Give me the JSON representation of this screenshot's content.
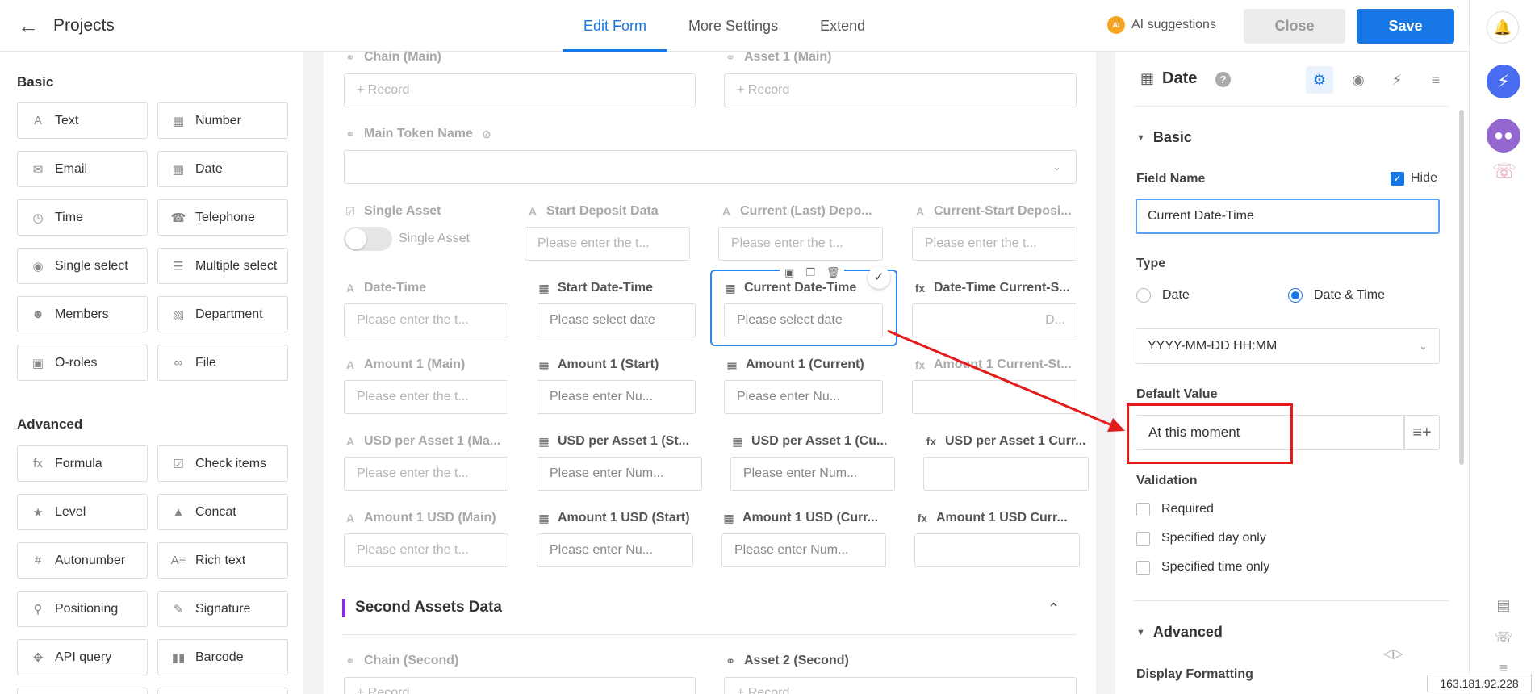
{
  "header": {
    "title": "Projects",
    "tabs": [
      "Edit Form",
      "More Settings",
      "Extend"
    ],
    "ai_suggestions": "AI suggestions",
    "ai_badge": "AI",
    "close": "Close",
    "save": "Save"
  },
  "sidebar": {
    "basic_title": "Basic",
    "advanced_title": "Advanced",
    "basic": [
      {
        "label": "Text",
        "icon": "text-icon"
      },
      {
        "label": "Number",
        "icon": "number-icon"
      },
      {
        "label": "Email",
        "icon": "email-icon"
      },
      {
        "label": "Date",
        "icon": "calendar-icon"
      },
      {
        "label": "Time",
        "icon": "clock-icon"
      },
      {
        "label": "Telephone",
        "icon": "phone-icon"
      },
      {
        "label": "Single select",
        "icon": "single-select-icon"
      },
      {
        "label": "Multiple select",
        "icon": "multi-select-icon"
      },
      {
        "label": "Members",
        "icon": "members-icon"
      },
      {
        "label": "Department",
        "icon": "department-icon"
      },
      {
        "label": "O-roles",
        "icon": "roles-icon"
      },
      {
        "label": "File",
        "icon": "attachment-icon"
      }
    ],
    "advanced": [
      {
        "label": "Formula",
        "icon": "formula-icon"
      },
      {
        "label": "Check items",
        "icon": "checkbox-icon"
      },
      {
        "label": "Level",
        "icon": "star-icon"
      },
      {
        "label": "Concat",
        "icon": "concat-icon"
      },
      {
        "label": "Autonumber",
        "icon": "hash-icon"
      },
      {
        "label": "Rich text",
        "icon": "rich-text-icon"
      },
      {
        "label": "Positioning",
        "icon": "location-icon"
      },
      {
        "label": "Signature",
        "icon": "signature-icon"
      },
      {
        "label": "API query",
        "icon": "api-icon"
      },
      {
        "label": "Barcode",
        "icon": "barcode-icon"
      }
    ]
  },
  "form": {
    "chain_main": "Chain (Main)",
    "asset1_main": "Asset 1 (Main)",
    "record": "+ Record",
    "main_token_name": "Main Token Name",
    "single_asset": "Single Asset",
    "single_asset_toggle": "Single Asset",
    "start_deposit_data": "Start Deposit Data",
    "current_last_depo": "Current (Last) Depo...",
    "current_start_deposi": "Current-Start Deposi...",
    "ph_text": "Please enter the t...",
    "date_time": "Date-Time",
    "start_date_time": "Start Date-Time",
    "current_date_time": "Current Date-Time",
    "date_time_current_s": "Date-Time Current-S...",
    "ph_select_date": "Please select date",
    "formula_placeholder": "D...",
    "amount1_main": "Amount 1 (Main)",
    "amount1_start": "Amount 1 (Start)",
    "amount1_current": "Amount 1 (Current)",
    "amount1_current_st": "Amount 1 Current-St...",
    "ph_num_short": "Please enter Nu...",
    "usd_asset1_main": "USD per Asset 1 (Ma...",
    "usd_asset1_start": "USD per Asset 1 (St...",
    "usd_asset1_current": "USD per Asset 1 (Cu...",
    "usd_asset1_curr": "USD per Asset 1 Curr...",
    "ph_num_long": "Please enter Num...",
    "amount1_usd_main": "Amount 1 USD (Main)",
    "amount1_usd_start": "Amount 1 USD (Start)",
    "amount1_usd_curr": "Amount 1 USD (Curr...",
    "amount1_usd_curr2": "Amount 1 USD Curr...",
    "second_assets": "Second Assets Data",
    "chain_second": "Chain (Second)",
    "asset2_second": "Asset 2 (Second)",
    "record_cut": "+ Record"
  },
  "panel": {
    "title": "Date",
    "basic": "Basic",
    "field_name_label": "Field Name",
    "hide": "Hide",
    "field_name_value": "Current Date-Time",
    "type_label": "Type",
    "type_date": "Date",
    "type_datetime": "Date & Time",
    "format": "YYYY-MM-DD HH:MM",
    "default_label": "Default Value",
    "default_value": "At this moment",
    "validation": "Validation",
    "required": "Required",
    "specified_day": "Specified day only",
    "specified_time": "Specified time only",
    "advanced": "Advanced",
    "display_formatting": "Display Formatting"
  },
  "ip_address": "163.181.92.228",
  "colors": {
    "accent": "#1677e5",
    "annotation": "#e31b1b",
    "section_bar": "#8a2be2"
  }
}
